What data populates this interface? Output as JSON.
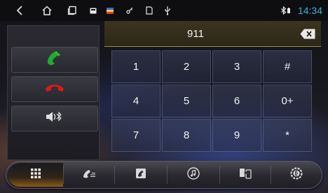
{
  "status_bar": {
    "icons": [
      "back-icon",
      "home-icon",
      "recent-apps-icon",
      "media-icon",
      "flag-icon",
      "key-icon",
      "sd-card-icon",
      "usb-icon"
    ],
    "bluetooth_icon": "bluetooth-battery-icon",
    "time": "14:34"
  },
  "dialer": {
    "number": "911",
    "backspace_icon": "backspace-icon",
    "keys": [
      "1",
      "2",
      "3",
      "#",
      "4",
      "5",
      "6",
      "0+",
      "7",
      "8",
      "9",
      "*"
    ]
  },
  "call_controls": {
    "answer_icon": "phone-answer-icon",
    "hangup_icon": "phone-hangup-icon",
    "audio_icon": "speaker-bluetooth-icon"
  },
  "bottom_nav": {
    "items": [
      "dialpad-icon",
      "call-log-icon",
      "contacts-icon",
      "music-icon",
      "phone-link-icon",
      "settings-icon"
    ],
    "active_index": 0
  },
  "colors": {
    "clock": "#37b4d9",
    "answer": "#1fae2a",
    "hangup": "#e01818",
    "active_accent": "#c98a2a"
  }
}
